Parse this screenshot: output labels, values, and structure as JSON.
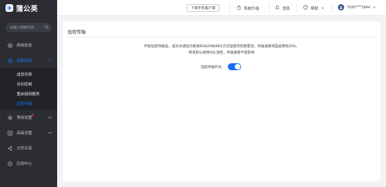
{
  "brand": {
    "name": "蒲公英"
  },
  "sidebar": {
    "search_placeholder": "请输入搜索内容",
    "items": [
      {
        "label": "网络状态",
        "icon": "network-icon"
      },
      {
        "label": "智能组网",
        "icon": "link-icon",
        "expanded": true,
        "sub": [
          {
            "label": "成员列表"
          },
          {
            "label": "访问控制"
          },
          {
            "label": "重启组网服务"
          },
          {
            "label": "加密传输",
            "active": true
          }
        ]
      },
      {
        "label": "常用设置",
        "icon": "gear-icon",
        "badge_color": "#f5222d"
      },
      {
        "label": "高级设置",
        "icon": "sliders-icon"
      },
      {
        "label": "文件共享",
        "icon": "share-icon"
      },
      {
        "label": "应用中心",
        "icon": "apps-icon"
      }
    ]
  },
  "topbar": {
    "download_label": "下载手机客户端",
    "upgrade_label": "系统升级",
    "messages_label": "消息",
    "help_label": "帮助",
    "user_label": "7026****1844"
  },
  "panel": {
    "title": "加密传输",
    "desc_line1": "开启加密传输后，成对点通信均使用RSA2048/AES方式加密所有数据流，传输速度将因此降低30%。",
    "desc_line2": "转发默认使用SSL加密，传输速度不受影响",
    "toggle_label": "加密传输开关：",
    "toggle_on": true
  },
  "colors": {
    "accent": "#1b6ef3",
    "sidebar_bg": "#2b2d33",
    "sidebar_sub_bg": "#212328"
  }
}
